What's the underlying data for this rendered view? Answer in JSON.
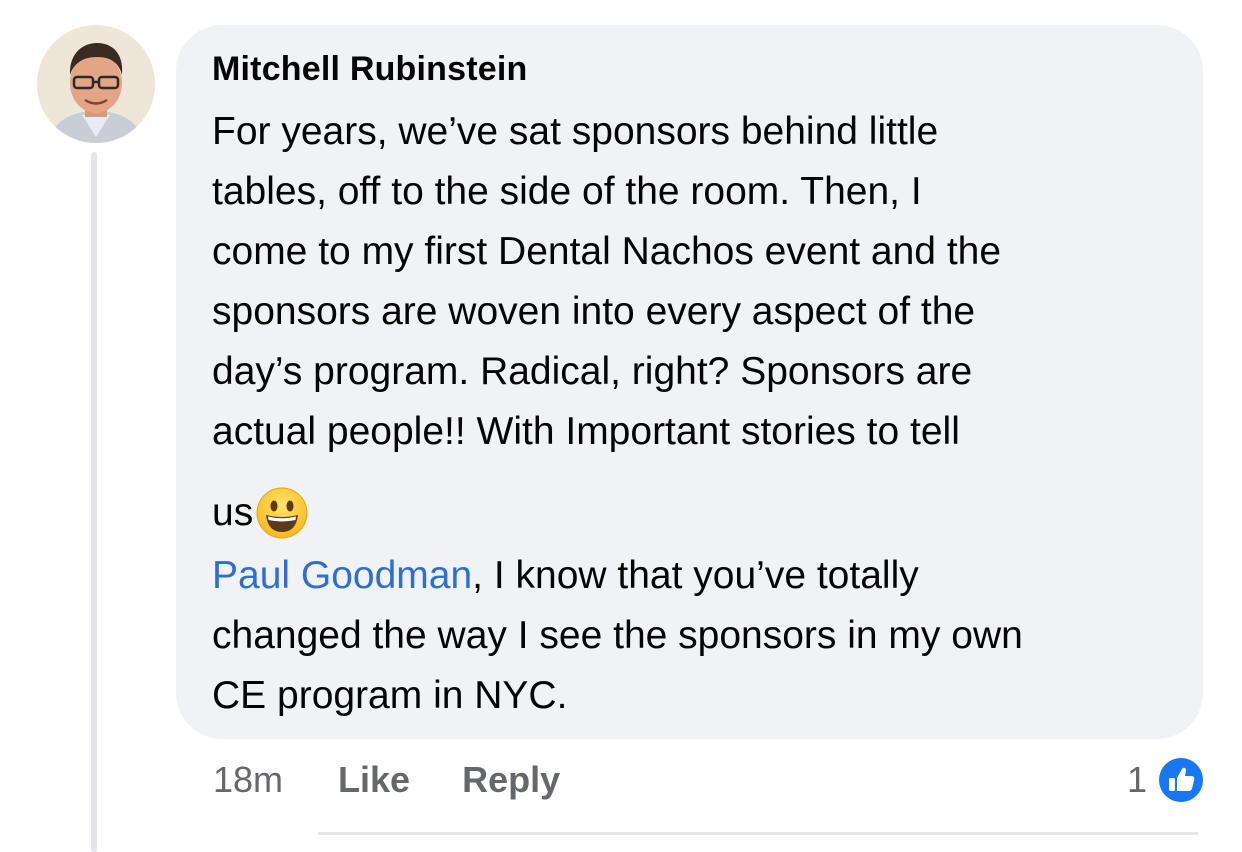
{
  "comment": {
    "author": "Mitchell Rubinstein",
    "body_lines": [
      "For years, we’ve sat sponsors behind little",
      "tables, off to the side of the room. Then, I",
      "come to my first Dental Nachos event and the",
      "sponsors are woven into every aspect of the",
      "day’s program. Radical, right? Sponsors are",
      "actual people!! With  Important stories to tell"
    ],
    "emoji_line_text": "us",
    "emoji": "grinning-face-emoji",
    "mention": "Paul Goodman",
    "reply_first_rest": ",  I know that you’ve totally",
    "reply_lines": [
      "changed the way I see the sponsors in my own",
      "CE program in NYC."
    ]
  },
  "actions": {
    "timestamp": "18m",
    "like_label": "Like",
    "reply_label": "Reply"
  },
  "reactions": {
    "count": "1",
    "icon": "thumbs-up-icon"
  },
  "colors": {
    "bubble": "#f0f2f5",
    "mention": "#2e6fd0",
    "like_badge": "#1877f2",
    "muted_text": "#65676b"
  }
}
